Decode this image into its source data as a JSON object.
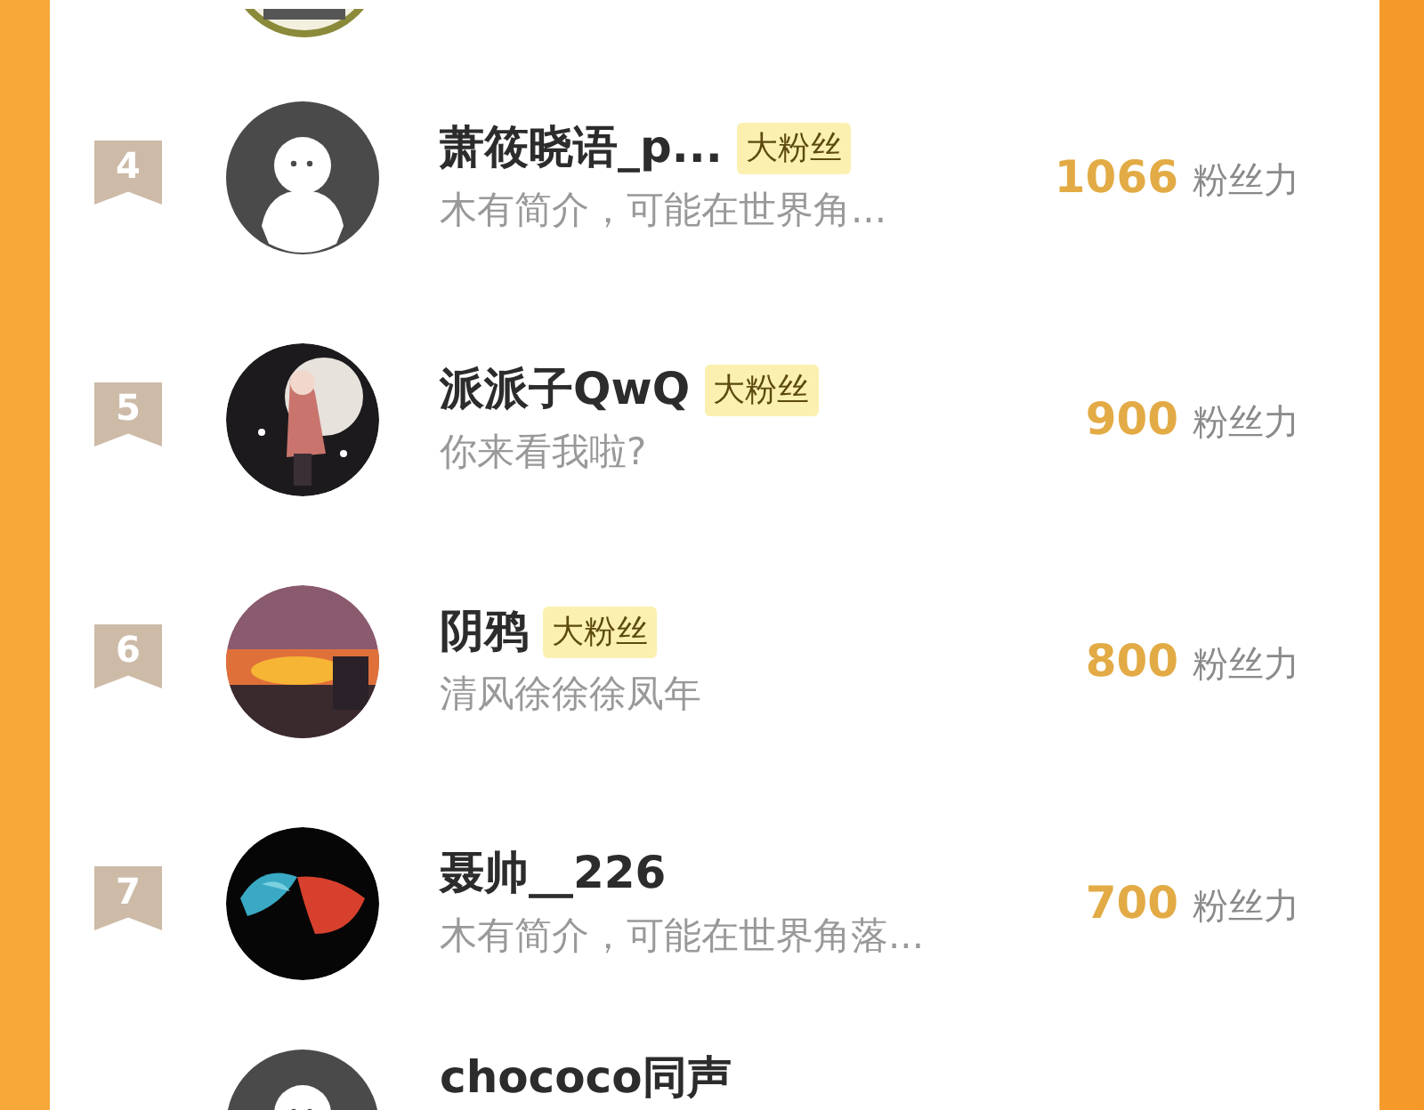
{
  "rows": [
    {
      "rank": "4",
      "avatar": {
        "kind": "default"
      },
      "name": "萧筱晓语_p...",
      "badge": "大粉丝",
      "bio": "木有简介，可能在世界角...",
      "score": "1066",
      "score_unit": "粉丝力"
    },
    {
      "rank": "5",
      "name": "派派子QwQ",
      "badge": "大粉丝",
      "bio": "你来看我啦?",
      "score": "900",
      "score_unit": "粉丝力"
    },
    {
      "rank": "6",
      "name": "阴鸦",
      "badge": "大粉丝",
      "bio": "清风徐徐徐凤年",
      "score": "800",
      "score_unit": "粉丝力"
    },
    {
      "rank": "7",
      "name": "聂帅__226",
      "bio": "木有简介，可能在世界角落...",
      "score": "700",
      "score_unit": "粉丝力"
    }
  ],
  "partial_row": {
    "avatar": {
      "kind": "default"
    },
    "name": "chococo同声"
  }
}
